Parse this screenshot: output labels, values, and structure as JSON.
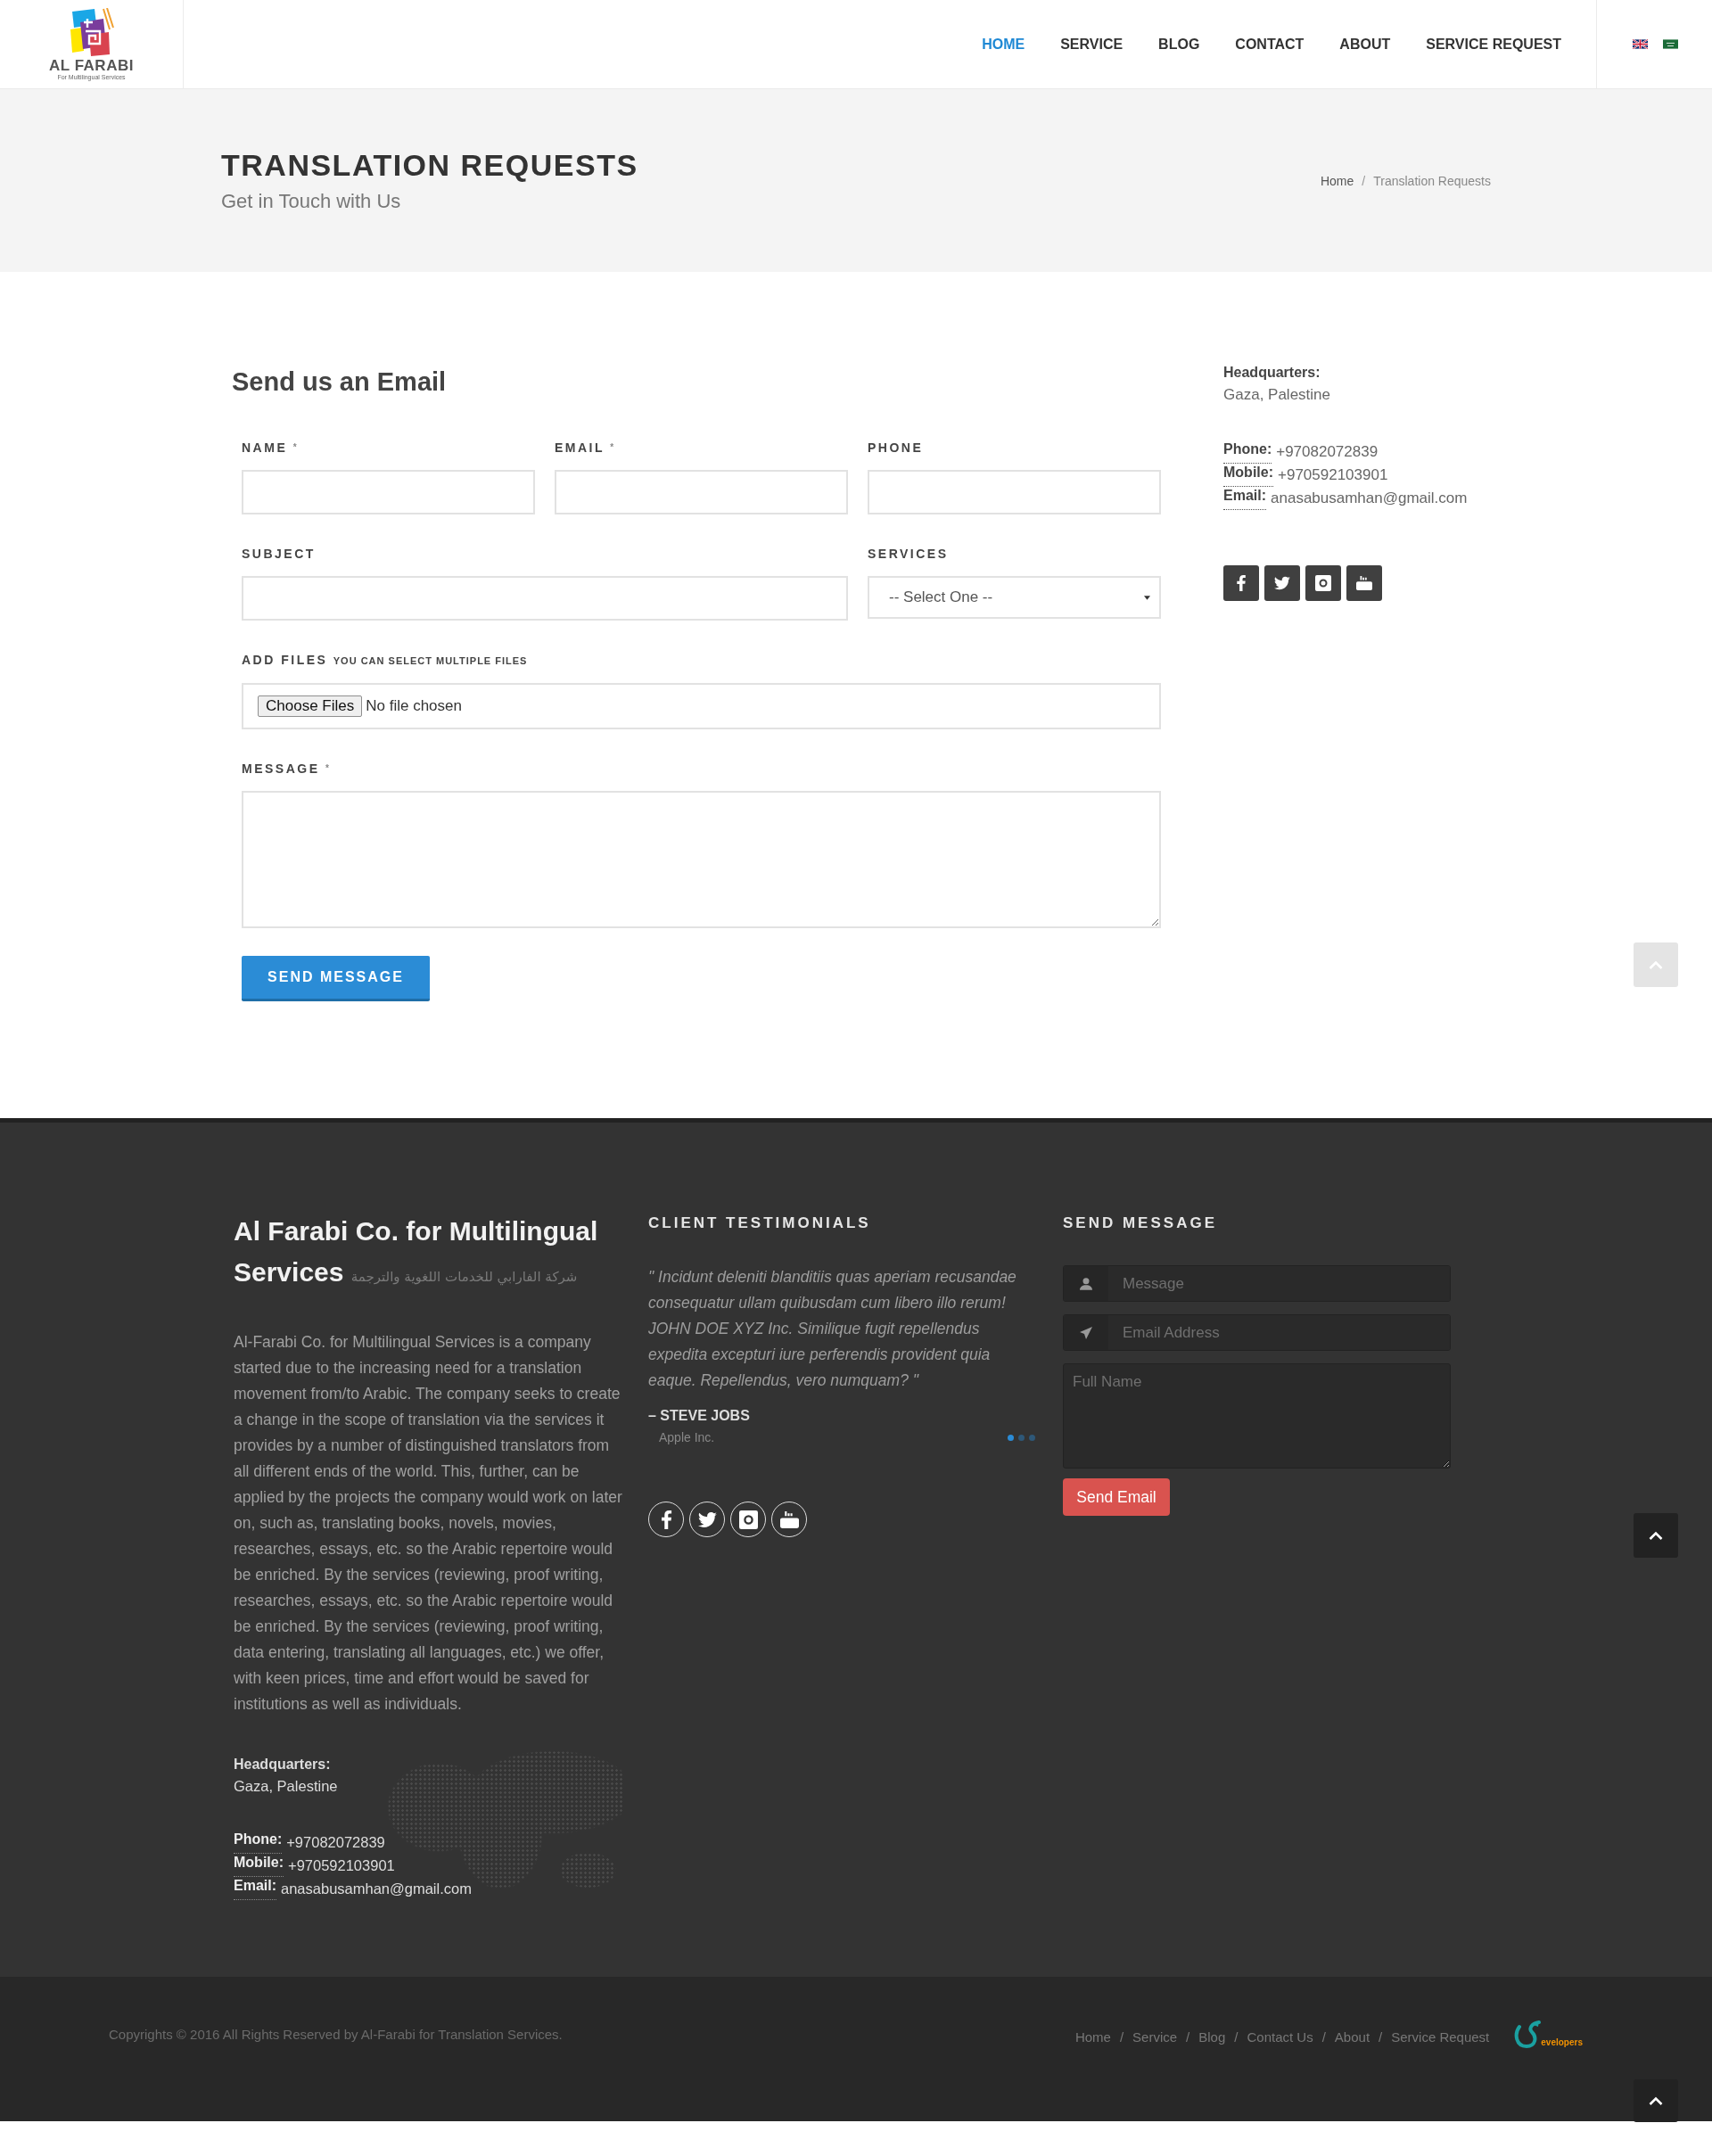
{
  "header": {
    "logo": {
      "title": "AL FARABI",
      "tagline": "For Multilingual Services"
    },
    "nav": [
      {
        "label": "HOME",
        "selected": true
      },
      {
        "label": "SERVICE",
        "selected": false
      },
      {
        "label": "BLOG",
        "selected": false
      },
      {
        "label": "CONTACT",
        "selected": false
      },
      {
        "label": "ABOUT",
        "selected": false
      },
      {
        "label": "SERVICE REQUEST",
        "selected": false
      }
    ]
  },
  "page_title": {
    "title": "TRANSLATION REQUESTS",
    "subtitle": "Get in Touch with Us",
    "breadcrumb": [
      {
        "label": "Home",
        "separator": "/"
      },
      {
        "label": "Translation Requests"
      }
    ]
  },
  "contact_form": {
    "heading": "Send us an Email",
    "fields": [
      {
        "kind": "text",
        "label": "NAME",
        "required_mark": "*"
      },
      {
        "kind": "text",
        "label": "EMAIL",
        "required_mark": "*"
      },
      {
        "kind": "text",
        "label": "PHONE"
      },
      {
        "kind": "text",
        "label": "SUBJECT"
      },
      {
        "kind": "select",
        "label": "SERVICES",
        "value": "-- Select One --"
      },
      {
        "kind": "file",
        "label": "ADD FILES",
        "hint": "YOU CAN SELECT MULTIPLE FILES",
        "button": "Choose Files",
        "value": "No file chosen"
      },
      {
        "kind": "textarea",
        "label": "MESSAGE",
        "required_mark": "*"
      }
    ],
    "submit": "SEND MESSAGE"
  },
  "contact_info": {
    "headquarters_label": "Headquarters:",
    "headquarters": "Gaza, Palestine",
    "lines": [
      {
        "label": "Phone:",
        "value": "+97082072839"
      },
      {
        "label": "Mobile:",
        "value": "+970592103901"
      },
      {
        "label": "Email:",
        "value": "anasabusamhan@gmail.com"
      }
    ]
  },
  "footer": {
    "about": {
      "title": "Al Farabi Co. for Multilingual Services",
      "title_arabic": "شركة الفارابي للخدمات اللغوية والترجمة",
      "paragraphs": [
        "Al-Farabi Co. for Multilingual Services is a company started due to the increasing need for a translation movement from/to Arabic. The company seeks to create a change in the scope of translation via the services it provides by a number of distinguished translators from all different ends of the world. This, further, can be applied by the projects the company would work on later on, such as, translating books, novels, movies, researches, essays, etc. so the Arabic repertoire would be enriched. By the services (reviewing, proof writing,",
        "researches, essays, etc. so the Arabic repertoire would be enriched. By the services (reviewing, proof writing, data entering, translating all languages, etc.) we offer, with keen prices, time and effort would be saved for institutions as well as individuals."
      ],
      "headquarters_label": "Headquarters:",
      "headquarters": "Gaza, Palestine",
      "lines": [
        {
          "label": "Phone:",
          "value": "+97082072839"
        },
        {
          "label": "Mobile:",
          "value": "+970592103901"
        },
        {
          "label": "Email:",
          "value": "anasabusamhan@gmail.com"
        }
      ]
    },
    "testimonials": {
      "heading": "CLIENT TESTIMONIALS",
      "quote": "\" Incidunt deleniti blanditiis quas aperiam recusandae consequatur ullam quibusdam cum libero illo rerum! JOHN DOE XYZ Inc. Similique fugit repellendus expedita excepturi iure perferendis provident quia eaque. Repellendus, vero numquam? \"",
      "author": "– STEVE JOBS",
      "company": "Apple Inc.",
      "dots": [
        {
          "selected": true
        },
        {
          "selected": false
        },
        {
          "selected": false
        }
      ]
    },
    "send_message": {
      "heading": "SEND MESSAGE",
      "fields": [
        {
          "kind": "user",
          "placeholder": "Message"
        },
        {
          "kind": "email",
          "placeholder": "Email Address"
        },
        {
          "kind": "textarea",
          "placeholder": "Full Name"
        }
      ],
      "button": "Send Email"
    }
  },
  "bottom_bar": {
    "copyright": "Copyrights © 2016 All Rights Reserved by Al-Farabi for Translation Services.",
    "links": [
      {
        "label": "Home",
        "separator": "/"
      },
      {
        "label": "Service",
        "separator": "/"
      },
      {
        "label": "Blog",
        "separator": "/"
      },
      {
        "label": "Contact Us",
        "separator": "/"
      },
      {
        "label": "About",
        "separator": "/"
      },
      {
        "label": "Service Request"
      }
    ],
    "developer_logo": "evelopers"
  }
}
